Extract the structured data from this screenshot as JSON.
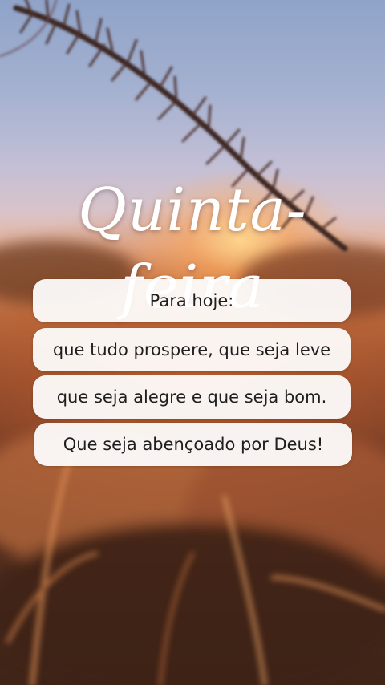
{
  "title": "Quinta- feira",
  "lines": [
    "Para hoje:",
    "que tudo prospere, que seja leve",
    "que seja alegre e que seja bom.",
    "Que seja abençoado por Deus!"
  ]
}
